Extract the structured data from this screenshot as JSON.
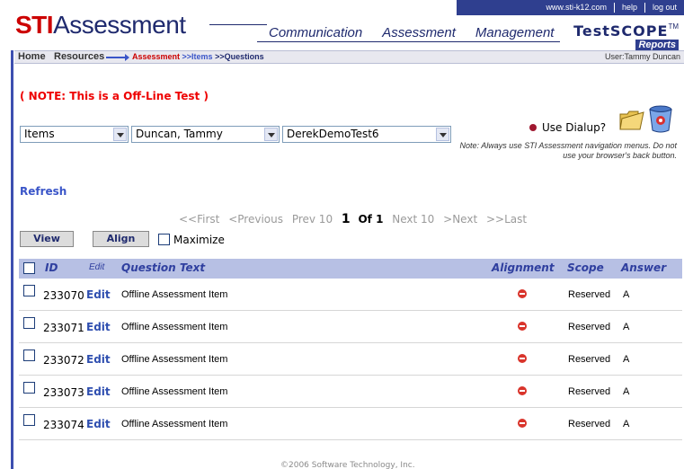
{
  "header": {
    "top_links": [
      "www.sti-k12.com",
      "help",
      "log out"
    ],
    "logo_bold": "STI",
    "logo_rest": "Assessment",
    "nav": [
      "Communication",
      "Assessment",
      "Management"
    ],
    "testscope": "TestSCOPE",
    "testscope_tm": "TM",
    "testscope_reports": "Reports"
  },
  "breadcrumb": {
    "home": "Home",
    "resources": "Resources",
    "trail_1": "Assessment",
    "trail_2": " >>Items",
    "trail_3": " >>Questions",
    "user": "User:Tammy Duncan"
  },
  "note": "( NOTE: This is a Off-Line Test )",
  "selects": {
    "type": "Items",
    "teacher": "Duncan, Tammy",
    "test": "DerekDemoTest6"
  },
  "dialup_label": "Use Dialup?",
  "nav_note": "Note: Always use STI Assessment navigation menus. Do not use your browser's back button.",
  "refresh": "Refresh",
  "pager": {
    "first": "<<First",
    "previous": "<Previous",
    "prev10": "Prev 10",
    "current": "1",
    "of": "Of 1",
    "next10": "Next 10",
    "next": ">Next",
    "last": ">>Last"
  },
  "buttons": {
    "view": "View",
    "align": "Align",
    "maximize": "Maximize"
  },
  "table": {
    "headers": {
      "id": "ID",
      "edit": "Edit",
      "question": "Question Text",
      "alignment": "Alignment",
      "scope": "Scope",
      "answer": "Answer"
    },
    "rows": [
      {
        "id": "233070",
        "edit": "Edit",
        "question": "Offline Assessment Item",
        "scope": "Reserved",
        "answer": "A"
      },
      {
        "id": "233071",
        "edit": "Edit",
        "question": "Offline Assessment Item",
        "scope": "Reserved",
        "answer": "A"
      },
      {
        "id": "233072",
        "edit": "Edit",
        "question": "Offline Assessment Item",
        "scope": "Reserved",
        "answer": "A"
      },
      {
        "id": "233073",
        "edit": "Edit",
        "question": "Offline Assessment Item",
        "scope": "Reserved",
        "answer": "A"
      },
      {
        "id": "233074",
        "edit": "Edit",
        "question": "Offline Assessment Item",
        "scope": "Reserved",
        "answer": "A"
      }
    ]
  },
  "footer": "©2006 Software Technology, Inc.",
  "colors": {
    "brand_red": "#cc0000",
    "brand_navy": "#1f2a6e",
    "header_bar": "#2f3f8f",
    "table_header": "#b7c0e4"
  }
}
